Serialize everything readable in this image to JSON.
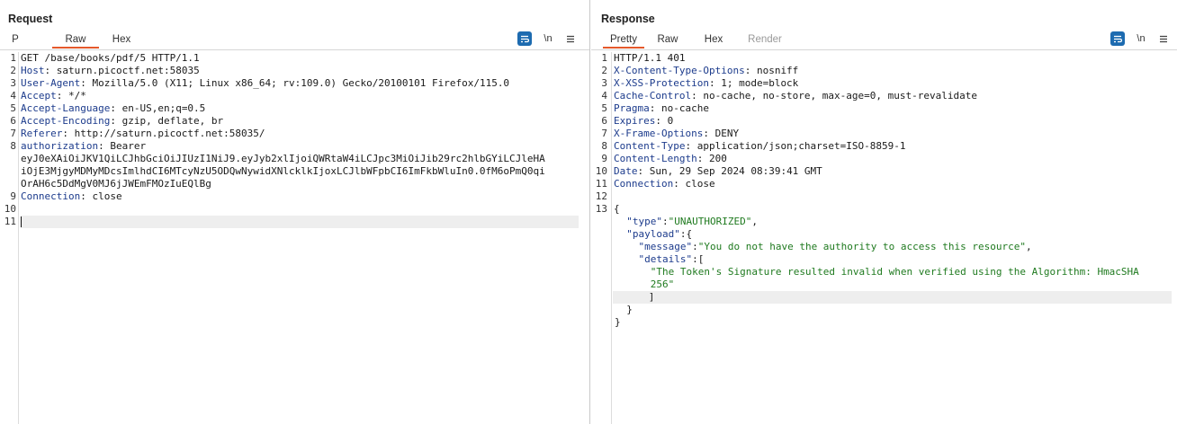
{
  "request": {
    "title": "Request",
    "tabs": [
      "P",
      "Raw",
      "Hex"
    ],
    "active_tab": "Raw",
    "newline_toggle": "\\n",
    "lines": [
      {
        "n": "1",
        "h": "",
        "v": "GET /base/books/pdf/5 HTTP/1.1"
      },
      {
        "n": "2",
        "h": "Host",
        "v": ": saturn.picoctf.net:58035"
      },
      {
        "n": "3",
        "h": "User-Agent",
        "v": ": Mozilla/5.0 (X11; Linux x86_64; rv:109.0) Gecko/20100101 Firefox/115.0"
      },
      {
        "n": "4",
        "h": "Accept",
        "v": ": */*"
      },
      {
        "n": "5",
        "h": "Accept-Language",
        "v": ": en-US,en;q=0.5"
      },
      {
        "n": "6",
        "h": "Accept-Encoding",
        "v": ": gzip, deflate, br"
      },
      {
        "n": "7",
        "h": "Referer",
        "v": ": http://saturn.picoctf.net:58035/"
      },
      {
        "n": "8",
        "h": "authorization",
        "v": ": Bearer"
      },
      {
        "n": "",
        "h": "",
        "v": "eyJ0eXAiOiJKV1QiLCJhbGciOiJIUzI1NiJ9.eyJyb2xlIjoiQWRtaW4iLCJpc3MiOiJib29rc2hlbGYiLCJleHA"
      },
      {
        "n": "",
        "h": "",
        "v": "iOjE3MjgyMDMyMDcsImlhdCI6MTcyNzU5ODQwNywidXNlcklkIjoxLCJlbWFpbCI6ImFkbWluIn0.0fM6oPmQ0qi"
      },
      {
        "n": "",
        "h": "",
        "v": "OrAH6c5DdMgV0MJ6jJWEmFMOzIuEQlBg"
      },
      {
        "n": "9",
        "h": "Connection",
        "v": ": close"
      },
      {
        "n": "10",
        "h": "",
        "v": ""
      },
      {
        "n": "11",
        "h": "",
        "v": ""
      }
    ]
  },
  "response": {
    "title": "Response",
    "tabs": [
      "Pretty",
      "Raw",
      "Hex",
      "Render"
    ],
    "active_tab": "Pretty",
    "newline_toggle": "\\n",
    "header_lines": [
      {
        "n": "1",
        "h": "",
        "v": "HTTP/1.1 401"
      },
      {
        "n": "2",
        "h": "X-Content-Type-Options",
        "v": ": nosniff"
      },
      {
        "n": "3",
        "h": "X-XSS-Protection",
        "v": ": 1; mode=block"
      },
      {
        "n": "4",
        "h": "Cache-Control",
        "v": ": no-cache, no-store, max-age=0, must-revalidate"
      },
      {
        "n": "5",
        "h": "Pragma",
        "v": ": no-cache"
      },
      {
        "n": "6",
        "h": "Expires",
        "v": ": 0"
      },
      {
        "n": "7",
        "h": "X-Frame-Options",
        "v": ": DENY"
      },
      {
        "n": "8",
        "h": "Content-Type",
        "v": ": application/json;charset=ISO-8859-1"
      },
      {
        "n": "9",
        "h": "Content-Length",
        "v": ": 200"
      },
      {
        "n": "10",
        "h": "Date",
        "v": ": Sun, 29 Sep 2024 08:39:41 GMT"
      },
      {
        "n": "11",
        "h": "Connection",
        "v": ": close"
      },
      {
        "n": "12",
        "h": "",
        "v": ""
      },
      {
        "n": "13",
        "h": "",
        "v": "{"
      }
    ],
    "json": {
      "type_key": "\"type\"",
      "type_val": "\"UNAUTHORIZED\"",
      "payload_key": "\"payload\"",
      "message_key": "\"message\"",
      "message_val": "\"You do not have the authority to access this resource\"",
      "details_key": "\"details\"",
      "details_val_1": "\"The Token's Signature resulted invalid when verified using the Algorithm: HmacSHA",
      "details_val_2": "256\""
    }
  },
  "colors": {
    "accent": "#e5592b",
    "header_name": "#1c3b8c",
    "json_string": "#1f7a1f",
    "toolbar_blue": "#1d6bb0"
  }
}
